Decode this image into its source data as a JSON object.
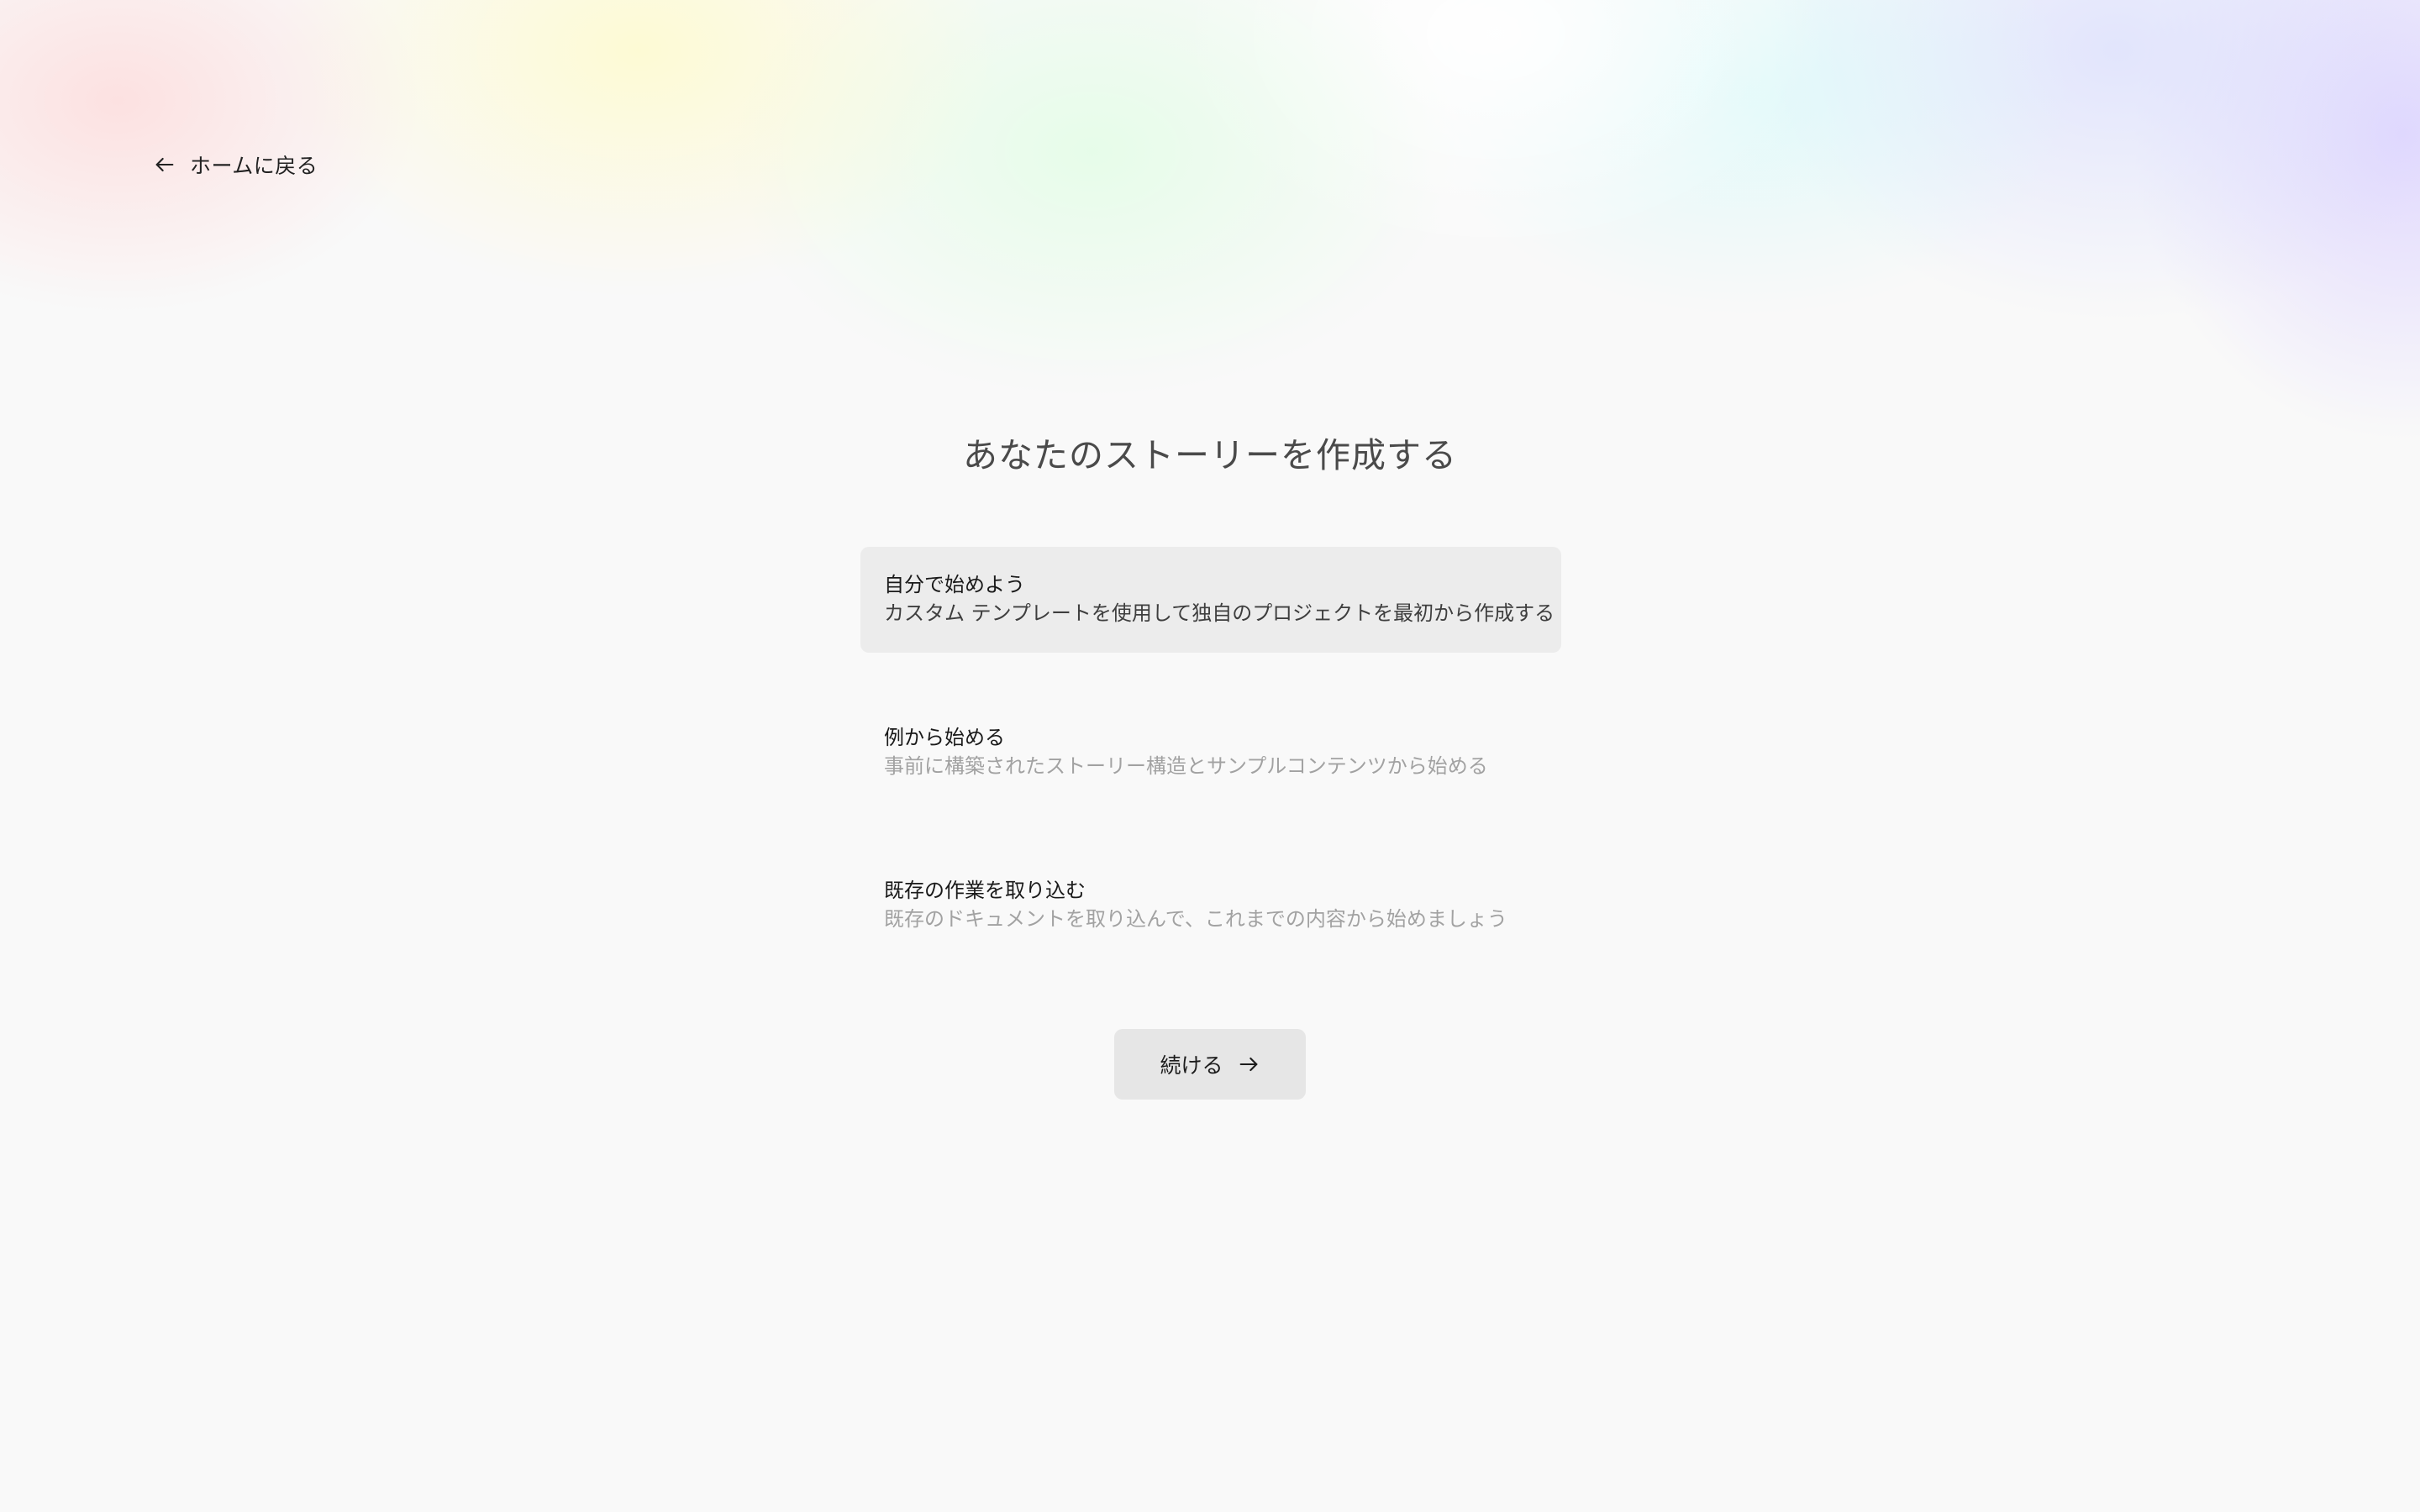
{
  "nav": {
    "back_label": "ホームに戻る",
    "back_icon": "arrow-left-icon"
  },
  "page": {
    "title": "あなたのストーリーを作成する"
  },
  "options": [
    {
      "title": "自分で始めよう",
      "description": "カスタム テンプレートを使用して独自のプロジェクトを最初から作成する",
      "selected": true
    },
    {
      "title": "例から始める",
      "description": "事前に構築されたストーリー構造とサンプルコンテンツから始める",
      "selected": false
    },
    {
      "title": "既存の作業を取り込む",
      "description": "既存のドキュメントを取り込んで、これまでの内容から始めましょう",
      "selected": false
    }
  ],
  "actions": {
    "continue_label": "続ける",
    "continue_icon": "arrow-right-icon"
  },
  "colors": {
    "background": "#f9f9f9",
    "selected_option": "#ececec",
    "button": "#e6e6e6",
    "muted_text": "#a2a2a2"
  }
}
